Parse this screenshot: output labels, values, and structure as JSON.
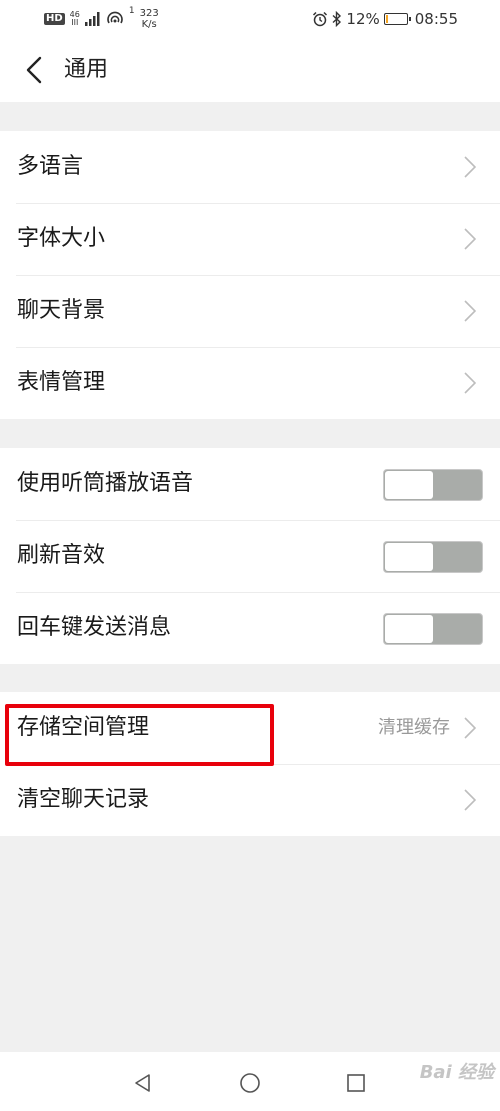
{
  "status_bar": {
    "hd": "HD",
    "net_top": "46",
    "net_bottom": "III",
    "hotspot_count": "1",
    "speed_value": "323",
    "speed_unit": "K/s",
    "battery_percent": "12%",
    "battery_level": 0.12,
    "time": "08:55"
  },
  "header": {
    "title": "通用"
  },
  "groups": [
    {
      "rows": [
        {
          "label": "多语言"
        },
        {
          "label": "字体大小"
        },
        {
          "label": "聊天背景"
        },
        {
          "label": "表情管理"
        }
      ]
    },
    {
      "rows": [
        {
          "label": "使用听筒播放语音",
          "toggle": "off"
        },
        {
          "label": "刷新音效",
          "toggle": "off"
        },
        {
          "label": "回车键发送消息",
          "toggle": "off"
        }
      ]
    },
    {
      "rows": [
        {
          "label": "存储空间管理",
          "value": "清理缓存"
        },
        {
          "label": "清空聊天记录"
        }
      ]
    }
  ],
  "colors": {
    "highlight_border": "#e8000b",
    "toggle_track": "#a9aca9",
    "battery_fill": "#f5a623"
  }
}
